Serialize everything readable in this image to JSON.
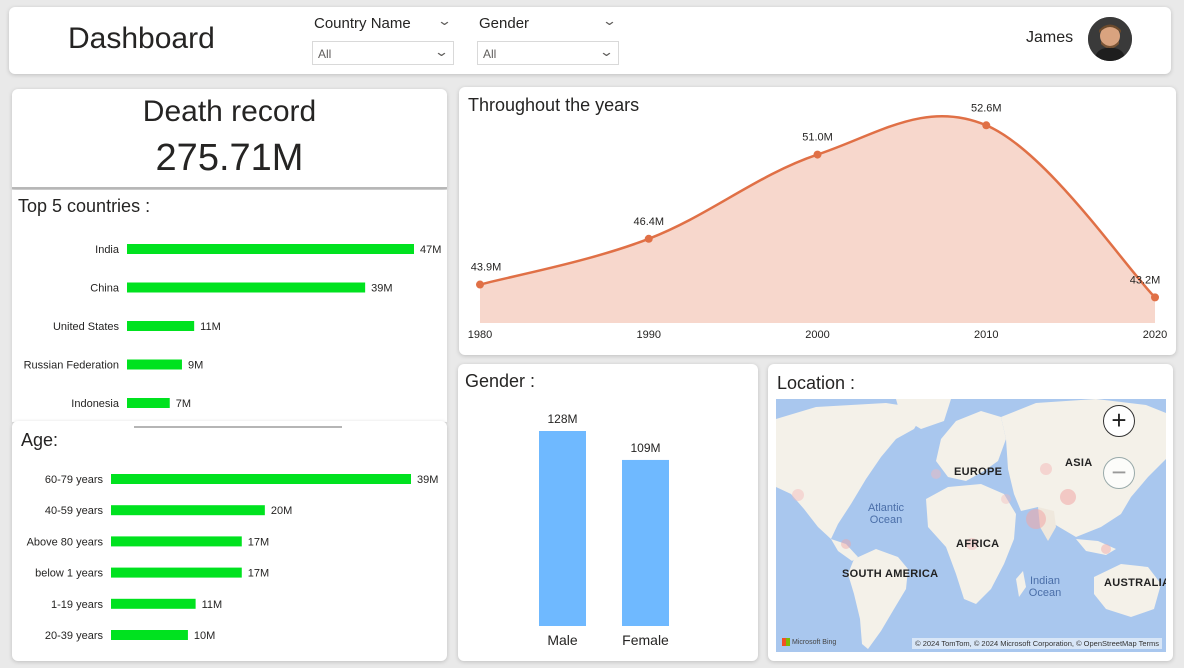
{
  "header": {
    "title": "Dashboard",
    "slicers": [
      {
        "title": "Country Name",
        "value": "All"
      },
      {
        "title": "Gender",
        "value": "All"
      }
    ],
    "user": "James"
  },
  "death_record": {
    "title": "Death record",
    "value": "275.71M"
  },
  "top_countries": {
    "title": "Top 5 countries :"
  },
  "age": {
    "title": "Age:"
  },
  "years": {
    "title": "Throughout the years"
  },
  "gender": {
    "title": "Gender :"
  },
  "location": {
    "title": "Location :",
    "labels": {
      "europe": "EUROPE",
      "asia": "ASIA",
      "africa": "AFRICA",
      "south_america": "SOUTH AMERICA",
      "australia": "AUSTRALIA",
      "atlantic": "Atlantic Ocean",
      "indian": "Indian Ocean"
    },
    "zoom_in": "+",
    "zoom_out": "−",
    "logo": "Microsoft Bing",
    "attribution": "© 2024 TomTom, © 2024 Microsoft Corporation, © OpenStreetMap  Terms"
  },
  "colors": {
    "bar_green": "#00e21f",
    "line_orange": "#e07046",
    "area_fill": "#f7d7cc",
    "bar_blue": "#6fb9ff"
  },
  "chart_data": [
    {
      "type": "bar",
      "orientation": "horizontal",
      "title": "Top 5 countries :",
      "categories": [
        "India",
        "China",
        "United States",
        "Russian Federation",
        "Indonesia"
      ],
      "values": [
        47,
        39,
        11,
        9,
        7
      ],
      "labels": [
        "47M",
        "39M",
        "11M",
        "9M",
        "7M"
      ]
    },
    {
      "type": "bar",
      "orientation": "horizontal",
      "title": "Age:",
      "categories": [
        "60-79 years",
        "40-59 years",
        "Above 80 years",
        "below 1 years",
        "1-19 years",
        "20-39 years"
      ],
      "values": [
        39,
        20,
        17,
        17,
        11,
        10
      ],
      "labels": [
        "39M",
        "20M",
        "17M",
        "17M",
        "11M",
        "10M"
      ]
    },
    {
      "type": "area",
      "title": "Throughout the years",
      "x": [
        1980,
        1990,
        2000,
        2010,
        2020
      ],
      "values": [
        43.9,
        46.4,
        51.0,
        52.6,
        43.2
      ],
      "labels": [
        "43.9M",
        "46.4M",
        "51.0M",
        "52.6M",
        "43.2M"
      ],
      "ylim": [
        41.8,
        53.6
      ]
    },
    {
      "type": "bar",
      "title": "Gender :",
      "categories": [
        "Male",
        "Female"
      ],
      "values": [
        128,
        109
      ],
      "labels": [
        "128M",
        "109M"
      ]
    }
  ]
}
